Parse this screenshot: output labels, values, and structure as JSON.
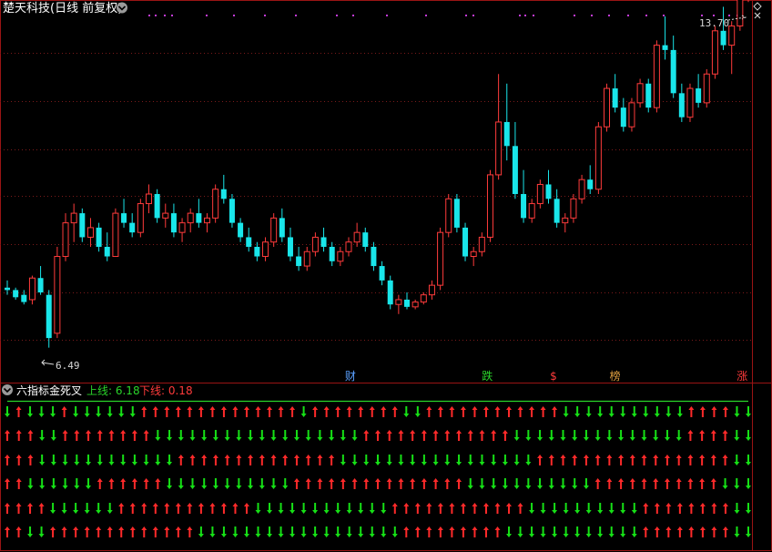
{
  "header": {
    "stock_title": "楚天科技(日线 前复权)",
    "dropdown_icon": "chevron-down-icon",
    "diamond_icon": "diamond-icon",
    "close_icon": "close-icon"
  },
  "indicator": {
    "title": "六指标金死叉",
    "upper_label": "上线: 6.18",
    "lower_label": "下线: 0.18"
  },
  "colors": {
    "up": "#ff3b3b",
    "down": "#19e6ea",
    "grid": "#7a1a1a",
    "frame": "#9a1414",
    "arrow_up": "#ff2a2a",
    "arrow_down": "#16e016",
    "indicator_line": "#2ad42a",
    "marker_dot": "#c23bd6"
  },
  "chart_data": {
    "type": "candlestick",
    "price_labels": {
      "high": "13.70",
      "low": "6.49"
    },
    "ylim": [
      6.0,
      14.0
    ],
    "grid": true,
    "candles": [
      [
        8.05,
        8.2,
        7.9,
        8.0
      ],
      [
        8.0,
        8.05,
        7.8,
        7.85
      ],
      [
        7.9,
        8.0,
        7.7,
        7.75
      ],
      [
        7.8,
        8.3,
        7.7,
        8.25
      ],
      [
        8.25,
        8.5,
        7.9,
        7.95
      ],
      [
        7.9,
        8.0,
        6.8,
        7.0
      ],
      [
        7.1,
        8.9,
        7.0,
        8.7
      ],
      [
        8.7,
        9.6,
        8.6,
        9.4
      ],
      [
        9.4,
        9.8,
        9.0,
        9.6
      ],
      [
        9.6,
        9.7,
        9.0,
        9.1
      ],
      [
        9.1,
        9.5,
        8.9,
        9.3
      ],
      [
        9.3,
        9.4,
        8.8,
        8.9
      ],
      [
        8.9,
        9.2,
        8.6,
        8.7
      ],
      [
        8.7,
        9.7,
        8.7,
        9.6
      ],
      [
        9.6,
        9.9,
        9.3,
        9.4
      ],
      [
        9.4,
        9.6,
        9.1,
        9.2
      ],
      [
        9.2,
        9.9,
        9.1,
        9.8
      ],
      [
        9.8,
        10.2,
        9.6,
        10.0
      ],
      [
        10.0,
        10.1,
        9.4,
        9.5
      ],
      [
        9.5,
        9.8,
        9.3,
        9.6
      ],
      [
        9.6,
        9.8,
        9.1,
        9.2
      ],
      [
        9.2,
        9.5,
        9.0,
        9.4
      ],
      [
        9.4,
        9.7,
        9.2,
        9.6
      ],
      [
        9.6,
        9.9,
        9.3,
        9.4
      ],
      [
        9.4,
        9.6,
        9.2,
        9.5
      ],
      [
        9.5,
        10.2,
        9.4,
        10.1
      ],
      [
        10.1,
        10.4,
        9.8,
        9.9
      ],
      [
        9.9,
        10.0,
        9.3,
        9.4
      ],
      [
        9.4,
        9.5,
        9.0,
        9.1
      ],
      [
        9.1,
        9.3,
        8.8,
        8.9
      ],
      [
        8.9,
        9.0,
        8.6,
        8.7
      ],
      [
        8.7,
        9.1,
        8.6,
        9.0
      ],
      [
        9.0,
        9.6,
        8.9,
        9.5
      ],
      [
        9.5,
        9.7,
        9.0,
        9.1
      ],
      [
        9.1,
        9.3,
        8.6,
        8.7
      ],
      [
        8.7,
        8.9,
        8.4,
        8.5
      ],
      [
        8.5,
        8.9,
        8.4,
        8.8
      ],
      [
        8.8,
        9.2,
        8.7,
        9.1
      ],
      [
        9.1,
        9.3,
        8.8,
        8.9
      ],
      [
        8.9,
        9.0,
        8.5,
        8.6
      ],
      [
        8.6,
        8.9,
        8.5,
        8.8
      ],
      [
        8.8,
        9.1,
        8.7,
        9.0
      ],
      [
        9.0,
        9.4,
        8.9,
        9.2
      ],
      [
        9.2,
        9.3,
        8.8,
        8.9
      ],
      [
        8.9,
        9.0,
        8.4,
        8.5
      ],
      [
        8.5,
        8.6,
        8.1,
        8.2
      ],
      [
        8.2,
        8.3,
        7.6,
        7.7
      ],
      [
        7.7,
        7.9,
        7.5,
        7.8
      ],
      [
        7.8,
        7.95,
        7.6,
        7.65
      ],
      [
        7.65,
        7.8,
        7.6,
        7.75
      ],
      [
        7.75,
        7.95,
        7.7,
        7.9
      ],
      [
        7.9,
        8.2,
        7.8,
        8.1
      ],
      [
        8.1,
        9.3,
        8.0,
        9.2
      ],
      [
        9.2,
        10.0,
        9.1,
        9.9
      ],
      [
        9.9,
        10.0,
        9.2,
        9.3
      ],
      [
        9.3,
        9.4,
        8.6,
        8.7
      ],
      [
        8.7,
        8.9,
        8.5,
        8.8
      ],
      [
        8.8,
        9.2,
        8.7,
        9.1
      ],
      [
        9.1,
        10.5,
        9.0,
        10.4
      ],
      [
        10.4,
        12.5,
        10.3,
        11.5
      ],
      [
        11.5,
        12.3,
        10.7,
        11.0
      ],
      [
        11.0,
        11.5,
        9.9,
        10.0
      ],
      [
        10.0,
        10.5,
        9.4,
        9.5
      ],
      [
        9.5,
        9.9,
        9.4,
        9.8
      ],
      [
        9.8,
        10.3,
        9.7,
        10.2
      ],
      [
        10.2,
        10.5,
        9.8,
        9.9
      ],
      [
        9.9,
        10.1,
        9.3,
        9.4
      ],
      [
        9.4,
        9.6,
        9.2,
        9.5
      ],
      [
        9.5,
        10.0,
        9.4,
        9.9
      ],
      [
        9.9,
        10.4,
        9.8,
        10.3
      ],
      [
        10.3,
        10.6,
        10.0,
        10.1
      ],
      [
        10.1,
        11.5,
        10.0,
        11.4
      ],
      [
        11.4,
        12.3,
        11.3,
        12.2
      ],
      [
        12.2,
        12.5,
        11.7,
        11.8
      ],
      [
        11.8,
        12.0,
        11.3,
        11.4
      ],
      [
        11.4,
        12.0,
        11.3,
        11.9
      ],
      [
        11.9,
        12.4,
        11.8,
        12.3
      ],
      [
        12.3,
        12.4,
        11.7,
        11.8
      ],
      [
        11.8,
        13.2,
        11.7,
        13.1
      ],
      [
        13.1,
        13.7,
        12.8,
        13.0
      ],
      [
        13.0,
        13.3,
        12.0,
        12.1
      ],
      [
        12.1,
        12.3,
        11.5,
        11.6
      ],
      [
        11.6,
        12.3,
        11.5,
        12.2
      ],
      [
        12.2,
        12.5,
        11.8,
        11.9
      ],
      [
        11.9,
        12.6,
        11.8,
        12.5
      ],
      [
        12.5,
        13.5,
        12.4,
        13.4
      ],
      [
        13.4,
        13.9,
        13.0,
        13.1
      ],
      [
        13.1,
        13.6,
        12.5,
        13.5
      ],
      [
        13.5,
        14.5,
        13.4,
        14.2
      ],
      [
        14.2,
        15.2,
        14.0,
        15.1
      ]
    ]
  },
  "event_labels": [
    {
      "text": "财",
      "pos": 0.466,
      "color": "#5aa0ff"
    },
    {
      "text": "跌",
      "pos": 0.648,
      "color": "#2ad42a"
    },
    {
      "text": "$",
      "pos": 0.736,
      "color": "#ff3b3b"
    },
    {
      "text": "榜",
      "pos": 0.818,
      "color": "#e0a040"
    },
    {
      "text": "涨",
      "pos": 0.987,
      "color": "#ff3b3b"
    }
  ],
  "signal_rows": [
    "dudddudddddduuuuuuuuuuuuuuduuuuuuuudduuuuuuuuuuuuddddddddddduuuudd",
    "uuudduuuuuuuudddddddddddddddddduuuuuuuuuuuuuddddddddddddddduuuudd",
    "uuudddddddddddduuuuuuuuuuuuuuddddddddddddddddduuuuuuuuuuuuuuuuudd",
    "uudddddduuuuuuddddddddddduuuuuuuuuuuuuuuddddddddddduuuuuuuuuuuddd",
    "uuuudddddduuuuuuuuuuuudddddddddddduuuuuuuuuuuudddddddddduuuuuuuudd",
    "uudduuuuuuuuuuuuudddddddddddddddddduuuuuuuuudddddddddddduuuuuuuudd"
  ]
}
